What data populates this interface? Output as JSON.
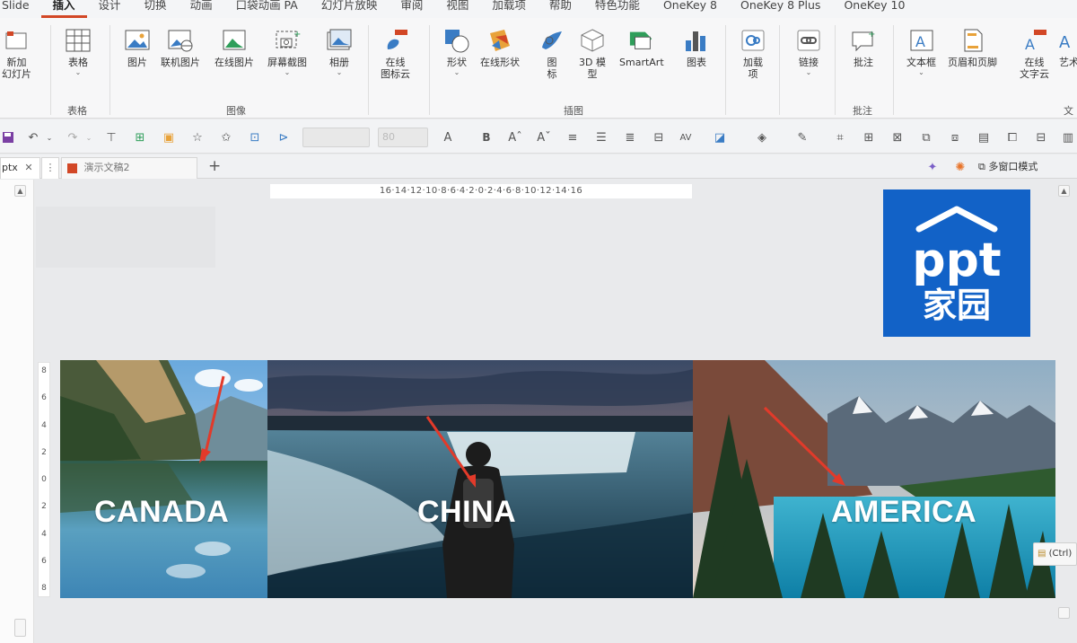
{
  "menu": {
    "items": [
      "Slide",
      "插入",
      "设计",
      "切换",
      "动画",
      "口袋动画 PA",
      "幻灯片放映",
      "审阅",
      "视图",
      "加载项",
      "帮助",
      "特色功能",
      "OneKey 8",
      "OneKey 8 Plus",
      "OneKey 10"
    ],
    "active_index": 1
  },
  "ribbon": {
    "new_slide": "新加\n幻灯片",
    "table": "表格",
    "group_table": "表格",
    "image": {
      "picture": "图片",
      "online_picture": "联机图片",
      "online_image": "在线图片",
      "screenshot": "屏幕截图",
      "album": "相册",
      "group_label": "图像"
    },
    "online_icons": "在线\n图标云",
    "illustration": {
      "shapes": "形状",
      "online_shapes": "在线形状",
      "icons": "图\n标",
      "model3d": "3D 模\n型",
      "smartart": "SmartArt",
      "chart": "图表",
      "group_label": "插图"
    },
    "addins": "加载\n项",
    "link": "链接",
    "comment": "批注",
    "group_comment": "批注",
    "text": {
      "textbox": "文本框",
      "header_footer": "页眉和页脚",
      "online_text": "在线\n文字云",
      "wordart": "艺术",
      "group_label": "文"
    }
  },
  "qat": {
    "font_box": "",
    "size_box": "80"
  },
  "tabs": [
    {
      "label": "ptx",
      "closable": true
    },
    {
      "label": "演示文稿2",
      "closable": false
    }
  ],
  "multi_window_label": "多窗口模式",
  "ruler": {
    "horizontal": "16·14·12·10·8·6·4·2·0·2·4·6·8·10·12·14·16",
    "vertical": [
      "8",
      "6",
      "4",
      "2",
      "0",
      "2",
      "4",
      "6",
      "8"
    ]
  },
  "logo": {
    "line1": "ppt",
    "line2": "家园",
    "color": "#1262c7"
  },
  "slide": {
    "captions": [
      "CANADA",
      "CHINA",
      "AMERICA"
    ]
  },
  "paste_chip": "(Ctrl)"
}
